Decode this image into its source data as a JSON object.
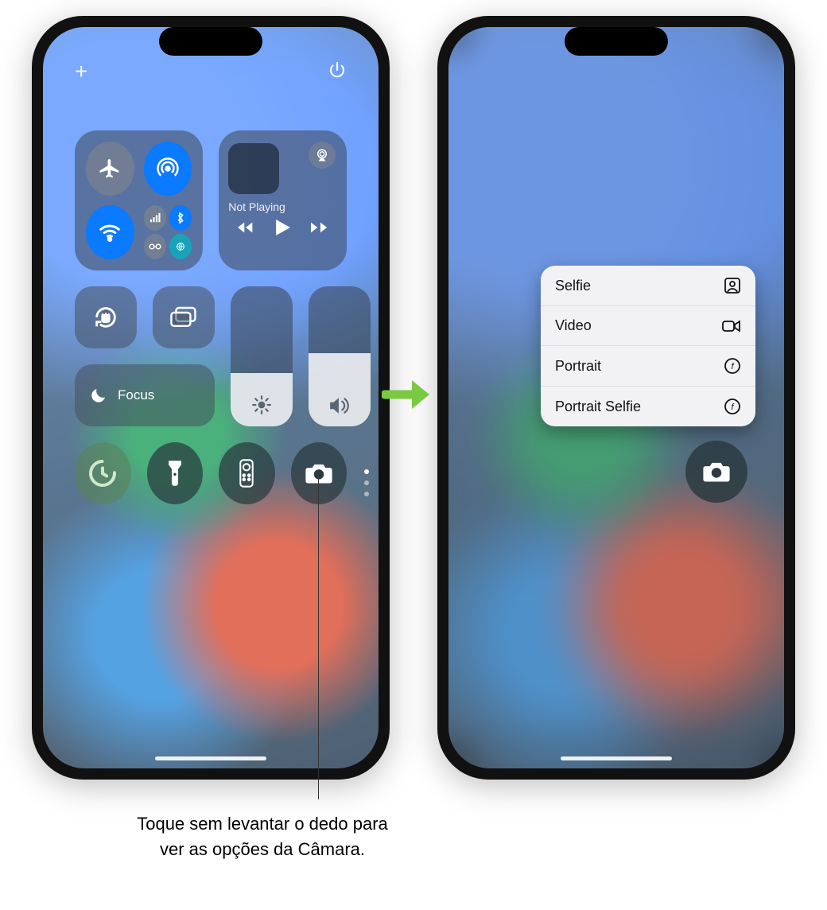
{
  "left_phone": {
    "topbar": {
      "add_glyph": "+",
      "power_glyph": "⏻"
    },
    "connectivity": {
      "airplane": {
        "on": false,
        "name": "airplane-mode-toggle"
      },
      "airdrop": {
        "on": true,
        "name": "airdrop-toggle"
      },
      "wifi": {
        "on": true,
        "name": "wifi-toggle"
      },
      "cluster": {
        "cellular": true,
        "bluetooth": true,
        "hotspot": false,
        "satellite": true
      }
    },
    "media": {
      "not_playing": "Not Playing"
    },
    "focus": {
      "label": "Focus"
    },
    "brightness_pct": 38,
    "volume_pct": 52,
    "side_indicators": [
      "♥",
      "♫",
      "⊚"
    ],
    "bottom_row": {
      "timer": "timer-button",
      "flashlight": "flashlight-button",
      "remote": "apple-tv-remote-button",
      "camera": "camera-button"
    }
  },
  "right_phone": {
    "camera_menu": {
      "items": [
        {
          "label": "Selfie",
          "icon": "person-square-icon"
        },
        {
          "label": "Video",
          "icon": "video-camera-icon"
        },
        {
          "label": "Portrait",
          "icon": "aperture-icon"
        },
        {
          "label": "Portrait Selfie",
          "icon": "aperture-icon"
        }
      ]
    }
  },
  "callout": {
    "text": "Toque sem levantar o dedo para ver as opções da Câmara."
  }
}
